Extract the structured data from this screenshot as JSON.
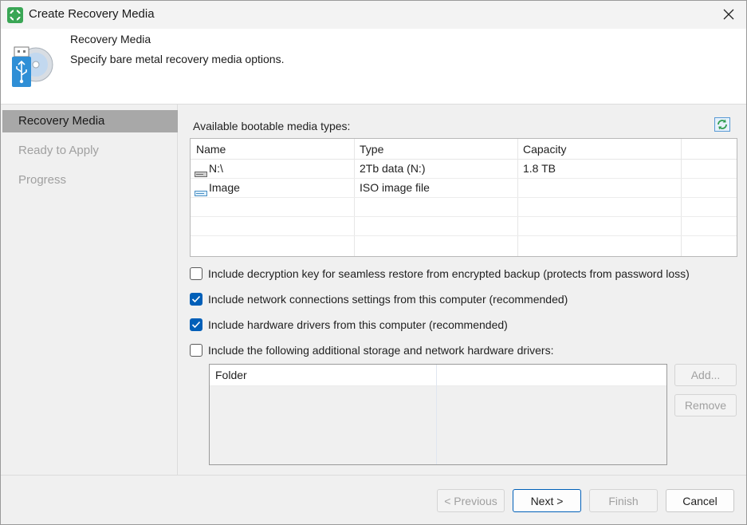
{
  "window": {
    "title": "Create Recovery Media",
    "app_icon": "veeam-agent-icon",
    "close_icon": "close-icon"
  },
  "header": {
    "title": "Recovery Media",
    "subtitle": "Specify bare metal recovery media options.",
    "icon": "usb-recovery-media-icon"
  },
  "nav": {
    "items": [
      {
        "label": "Recovery Media",
        "active": true
      },
      {
        "label": "Ready to Apply",
        "active": false
      },
      {
        "label": "Progress",
        "active": false
      }
    ]
  },
  "media": {
    "label": "Available bootable media types:",
    "refresh_icon": "refresh-icon",
    "columns": [
      "Name",
      "Type",
      "Capacity"
    ],
    "rows": [
      {
        "name": "N:\\",
        "type": "2Tb data (N:)",
        "capacity": "1.8 TB",
        "icon": "drive-icon"
      },
      {
        "name": "Image",
        "type": "ISO image file",
        "capacity": "",
        "icon": "image-drive-icon"
      }
    ]
  },
  "options": [
    {
      "label": "Include decryption key for seamless restore from encrypted backup (protects from password loss)",
      "checked": false
    },
    {
      "label": "Include network connections settings from this computer (recommended)",
      "checked": true
    },
    {
      "label": "Include hardware drivers from this computer (recommended)",
      "checked": true
    },
    {
      "label": "Include the following additional storage and network hardware drivers:",
      "checked": false
    }
  ],
  "drivers": {
    "columns": [
      "Folder"
    ],
    "add_label": "Add...",
    "remove_label": "Remove"
  },
  "footer": {
    "previous_label": "< Previous",
    "next_label": "Next >",
    "finish_label": "Finish",
    "cancel_label": "Cancel"
  },
  "colors": {
    "accent": "#005fb8",
    "nav_active_bg": "#a8a8a8",
    "disabled_text": "#a0a0a0"
  }
}
